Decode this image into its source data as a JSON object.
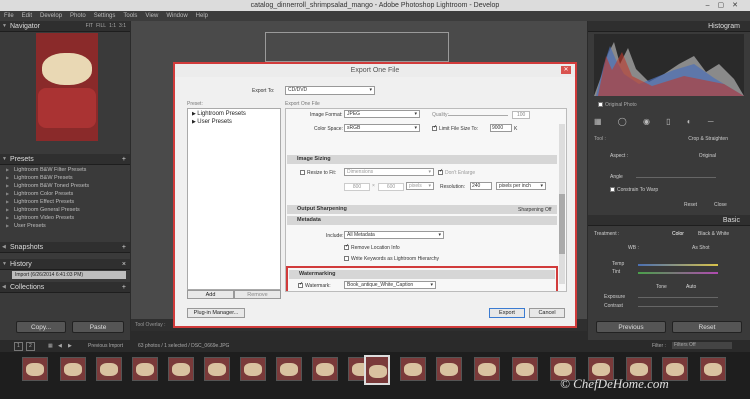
{
  "window": {
    "title": "catalog_dinnerroll_shrimpsalad_mango - Adobe Photoshop Lightroom - Develop"
  },
  "menu": [
    "File",
    "Edit",
    "Develop",
    "Photo",
    "Settings",
    "Tools",
    "View",
    "Window",
    "Help"
  ],
  "left": {
    "navigator": "Navigator",
    "nav_modes": [
      "FIT",
      "FILL",
      "1:1",
      "3:1"
    ],
    "presets": "Presets",
    "preset_items": [
      "Lightroom B&W Filter Presets",
      "Lightroom B&W Presets",
      "Lightroom B&W Toned Presets",
      "Lightroom Color Presets",
      "Lightroom Effect Presets",
      "Lightroom General Presets",
      "Lightroom Video Presets",
      "User Presets"
    ],
    "snapshots": "Snapshots",
    "history": "History",
    "history_item": "Import (6/26/2014 6:41:03 PM)",
    "collections": "Collections",
    "copy": "Copy...",
    "paste": "Paste"
  },
  "right": {
    "histogram": "Histogram",
    "original_photo": "Original Photo",
    "tool": "Tool :",
    "crop": "Crop & Straighten",
    "aspect": "Aspect :",
    "original": "Original",
    "angle": "Angle",
    "constrain": "Constrain To Warp",
    "reset": "Reset",
    "close": "Close",
    "basic": "Basic",
    "treatment": "Treatment :",
    "color": "Color",
    "bw": "Black & White",
    "wb": "WB :",
    "as_shot": "As Shot",
    "temp": "Temp",
    "tint": "Tint",
    "tone": "Tone",
    "auto": "Auto",
    "exposure": "Exposure",
    "contrast": "Contrast",
    "previous": "Previous",
    "reset_btn": "Reset"
  },
  "toolbar": {
    "tool_overlay": "Tool Overlay :"
  },
  "filmstrip": {
    "pages": [
      "1",
      "2"
    ],
    "source": "Previous Import",
    "info": "63 photos / 1 selected / DSC_0669e.JPG",
    "filter": "Filter :",
    "filters_off": "Filters Off"
  },
  "dialog": {
    "title": "Export One File",
    "export_to_label": "Export To:",
    "export_to": "CD/DVD",
    "presets_label": "Preset:",
    "export_one_file": "Export One File",
    "preset_items": [
      "Lightroom Presets",
      "User Presets"
    ],
    "add": "Add",
    "remove": "Remove",
    "image_format_label": "Image Format:",
    "image_format": "JPEG",
    "quality_label": "Quality:",
    "quality": "100",
    "color_space_label": "Color Space:",
    "color_space": "sRGB",
    "limit_label": "Limit File Size To:",
    "limit_value": "9000",
    "limit_unit": "K",
    "image_sizing": "Image Sizing",
    "resize_label": "Resize to Fit:",
    "resize_value": "Dimensions",
    "dont_enlarge": "Don't Enlarge",
    "w": "800",
    "x": "×",
    "h": "600",
    "px": "pixels",
    "resolution_label": "Resolution:",
    "resolution": "240",
    "res_unit": "pixels per inch",
    "output_sharpening": "Output Sharpening",
    "sharpening_off": "Sharpening Off",
    "metadata": "Metadata",
    "include_label": "Include:",
    "include": "All Metadata",
    "remove_location": "Remove Location Info",
    "write_keywords": "Write Keywords as Lightroom Hierarchy",
    "watermarking": "Watermarking",
    "watermark_label": "Watermark:",
    "watermark": "Book_antique_White_Caption",
    "plugin": "Plug-in Manager...",
    "export": "Export",
    "cancel": "Cancel"
  },
  "watermark_text": "© ChefDeHome.com"
}
